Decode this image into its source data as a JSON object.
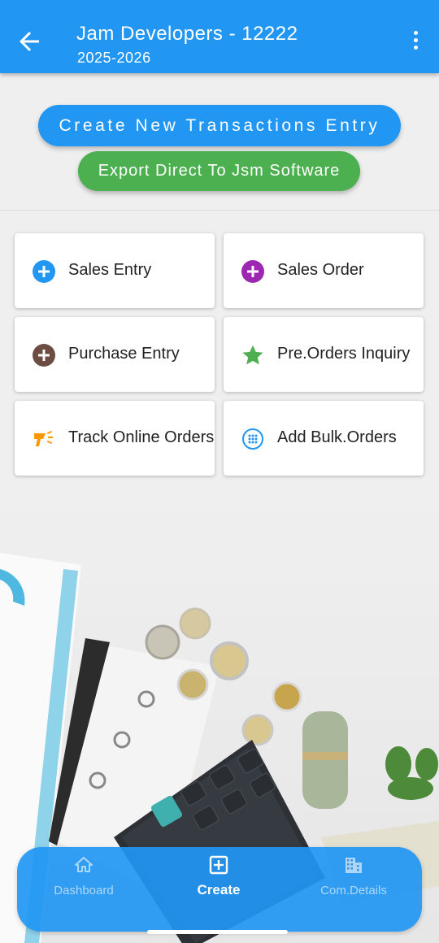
{
  "header": {
    "title": "Jam Developers - 12222",
    "subtitle": "2025-2026"
  },
  "actions": {
    "create_label": "Create New Transactions Entry",
    "export_label": "Export Direct To Jsm Software"
  },
  "cards": [
    {
      "label": "Sales Entry",
      "icon": "plus-circle-icon",
      "color": "#2196f3"
    },
    {
      "label": "Sales Order",
      "icon": "plus-circle-icon",
      "color": "#9c27b0"
    },
    {
      "label": "Purchase Entry",
      "icon": "plus-circle-icon",
      "color": "#6d4c41"
    },
    {
      "label": "Pre.Orders Inquiry",
      "icon": "star-icon",
      "color": "#4caf50"
    },
    {
      "label": "Track Online Orders",
      "icon": "scanner-icon",
      "color": "#ff9800"
    },
    {
      "label": "Add Bulk.Orders",
      "icon": "dots-circle-icon",
      "color": "#2196f3"
    }
  ],
  "bottom_nav": {
    "items": [
      {
        "label": "Dashboard",
        "icon": "home-icon"
      },
      {
        "label": "Create",
        "icon": "add-box-icon"
      },
      {
        "label": "Com.Details",
        "icon": "building-icon"
      }
    ],
    "active_index": 1
  },
  "colors": {
    "primary": "#2196f3",
    "success": "#4caf50"
  }
}
